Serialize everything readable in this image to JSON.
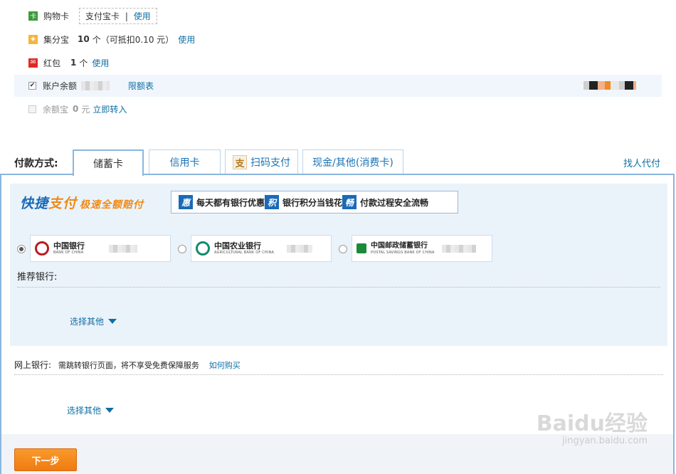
{
  "options": {
    "gift_card": {
      "label": "购物卡",
      "box_text": "支付宝卡",
      "separator": "|",
      "use_link": "使用"
    },
    "jifenbao": {
      "label": "集分宝",
      "count": "10",
      "unit": "个",
      "note": "（可抵扣0.10 元）",
      "use_link": "使用"
    },
    "hongbao": {
      "label": "红包",
      "count": "1",
      "unit": "个",
      "use_link": "使用"
    },
    "balance": {
      "label": "账户余额",
      "limit_link": "限额表"
    },
    "yuebao": {
      "label": "余额宝",
      "amount": "0",
      "unit": "元",
      "transfer_link": "立即转入"
    }
  },
  "payment": {
    "label": "付款方式:",
    "tabs": [
      {
        "label": "储蓄卡",
        "active": true
      },
      {
        "label": "信用卡",
        "active": false
      },
      {
        "label": "扫码支付",
        "active": false,
        "icon": "支"
      },
      {
        "label": "现金/其他(消费卡)",
        "active": false
      }
    ],
    "help_link": "找人代付"
  },
  "quick": {
    "logo_a": "快捷",
    "logo_b": "支付",
    "logo_sub": "极速全额赔付",
    "promos": [
      {
        "badge": "惠",
        "text": "每天都有银行优惠"
      },
      {
        "badge": "积",
        "text": "银行积分当钱花"
      },
      {
        "badge": "畅",
        "text": "付款过程安全流畅"
      }
    ],
    "banks": [
      {
        "name": "中国银行",
        "en": "BANK OF CHINA",
        "selected": true,
        "color": "#b81c22"
      },
      {
        "name": "中国农业银行",
        "en": "AGRICULTURAL BANK OF CHINA",
        "selected": false,
        "color": "#148a6b"
      },
      {
        "name": "中国邮政储蓄银行",
        "en": "POSTAL SAVINGS BANK OF CHINA",
        "selected": false,
        "color": "#1a8a3a"
      }
    ],
    "recommend_label": "推荐银行:",
    "select_other": "选择其他"
  },
  "ebank": {
    "label": "网上银行:",
    "note": "需跳转银行页面，将不享受免费保障服务",
    "how_link": "如何购买",
    "select_other": "选择其他"
  },
  "next_button": "下一步",
  "watermark": {
    "main": "Baidu经验",
    "sub": "jingyan.baidu.com"
  }
}
